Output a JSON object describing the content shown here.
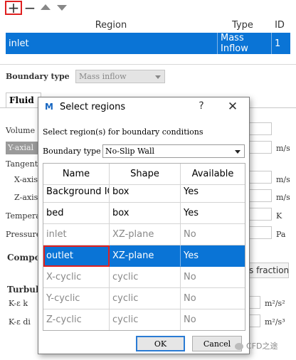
{
  "toolbar": {
    "add_glyph": "+",
    "remove_glyph": "−"
  },
  "regions_table": {
    "headers": [
      "Region",
      "Type",
      "ID"
    ],
    "row": {
      "region": "inlet",
      "type": "Mass Inflow",
      "id": "1"
    }
  },
  "boundary_form": {
    "boundary_type_label": "Boundary type",
    "boundary_type_value": "Mass inflow",
    "tab_fluid": "Fluid",
    "volume_label": "Volume f",
    "yaxial_value": "Y-axial",
    "tangential_label": "Tangenti",
    "xaxis_label": "X-axis",
    "zaxis_label": "Z-axis",
    "temperature_label": "Temperat",
    "pressure_label": "Pressure",
    "composition_label": "Compos",
    "turbulence_label": "Turbul",
    "k_eps_1_label": "K-ε k",
    "k_eps_2_label": "K-ε di",
    "mass_fraction_button": "s fraction",
    "units": {
      "vol": "m/s",
      "x": "m/s",
      "z": "m/s",
      "temp": "K",
      "pressure": "Pa",
      "k1": "m²/s²",
      "k2": "m²/s³"
    }
  },
  "dialog": {
    "logo_text": "M",
    "title": "Select regions",
    "help_glyph": "?",
    "close_glyph": "✕",
    "prompt": "Select region(s) for boundary conditions",
    "boundary_type_label": "Boundary type",
    "boundary_type_value": "No-Slip Wall",
    "columns": [
      "Name",
      "Shape",
      "Available"
    ],
    "rows": [
      {
        "name": "Background IC",
        "shape": "box",
        "available": "Yes",
        "enabled": true
      },
      {
        "name": "bed",
        "shape": "box",
        "available": "Yes",
        "enabled": true
      },
      {
        "name": "inlet",
        "shape": "XZ-plane",
        "available": "No",
        "enabled": false
      },
      {
        "name": "outlet",
        "shape": "XZ-plane",
        "available": "Yes",
        "enabled": true,
        "selected": true
      },
      {
        "name": "X-cyclic",
        "shape": "cyclic",
        "available": "No",
        "enabled": false
      },
      {
        "name": "Y-cyclic",
        "shape": "cyclic",
        "available": "No",
        "enabled": false
      },
      {
        "name": "Z-cyclic",
        "shape": "cyclic",
        "available": "No",
        "enabled": false
      }
    ],
    "ok_label": "OK",
    "cancel_label": "Cancel"
  },
  "watermark": "CFD之途",
  "colors": {
    "selection": "#0a74d6",
    "highlight_border": "#e02020",
    "disabled_text": "#888888"
  }
}
